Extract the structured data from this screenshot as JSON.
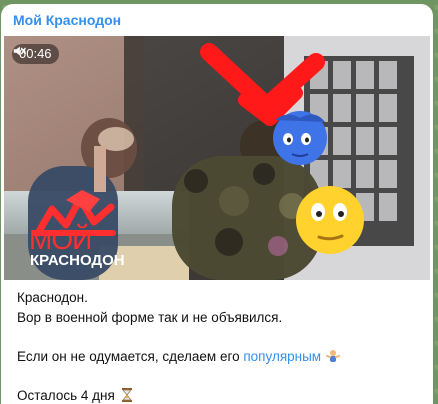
{
  "channel": {
    "name": "Мой Краснодон"
  },
  "video": {
    "duration": "00:46",
    "overlay_top": "МОЙ",
    "overlay_bottom": "КРАСНОДОН",
    "muted_icon": "mute-icon"
  },
  "message": {
    "line1": "Краснодон.",
    "line2": "Вор в военной форме так и не объявился.",
    "line3_before": "Если он не одумается, сделаем его",
    "line3_link": "популярным",
    "line4": "Осталось 4 дня",
    "emoji1": "person-shrugging-icon",
    "emoji2": "hourglass-icon"
  },
  "colors": {
    "accent": "#3390ec",
    "background": "#6f9562"
  }
}
